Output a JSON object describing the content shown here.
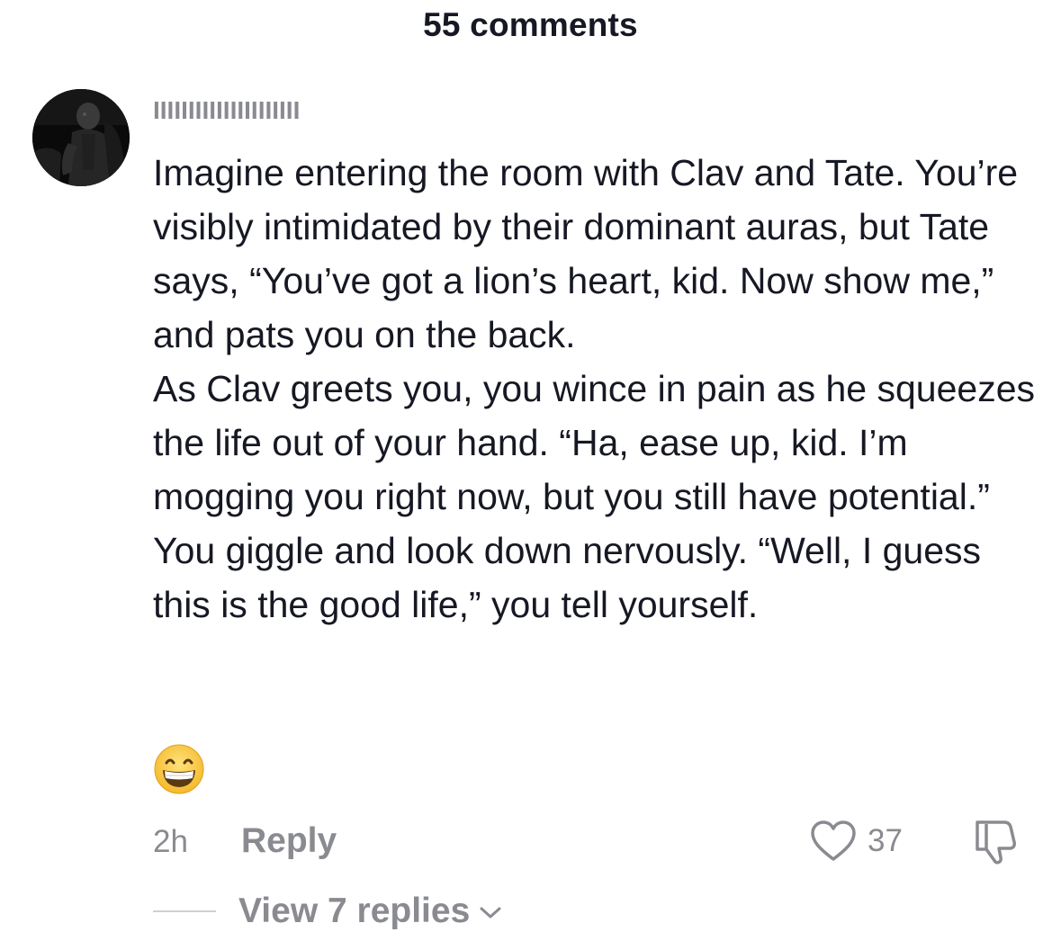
{
  "header": {
    "title": "55 comments"
  },
  "comment": {
    "username": "IIIIIIIIIIIIIIIIIIIII",
    "paragraphs": [
      "Imagine entering the room with Clav and Tate. You’re visibly intimidated by their dominant auras, but Tate says, “You’ve got a lion’s heart, kid. Now show me,” and pats you on the back.",
      "As Clav greets you, you wince in pain as he squeezes the life out of your hand. “Ha, ease up, kid. I’m mogging you right now, but you still have potential.”",
      "You giggle and look down nervously. “Well, I guess this is the good life,” you tell yourself."
    ],
    "emoji": "grinning-face-with-smiling-eyes",
    "time": "2h",
    "reply_label": "Reply",
    "like_count": "37",
    "view_replies_label": "View 7 replies"
  },
  "icons": {
    "like": "heart-outline-icon",
    "dislike": "thumbs-down-outline-icon",
    "expand": "chevron-down-icon"
  },
  "colors": {
    "text_primary": "#161823",
    "text_secondary": "#8a8b91",
    "emoji_yellow": "#f6c237"
  }
}
